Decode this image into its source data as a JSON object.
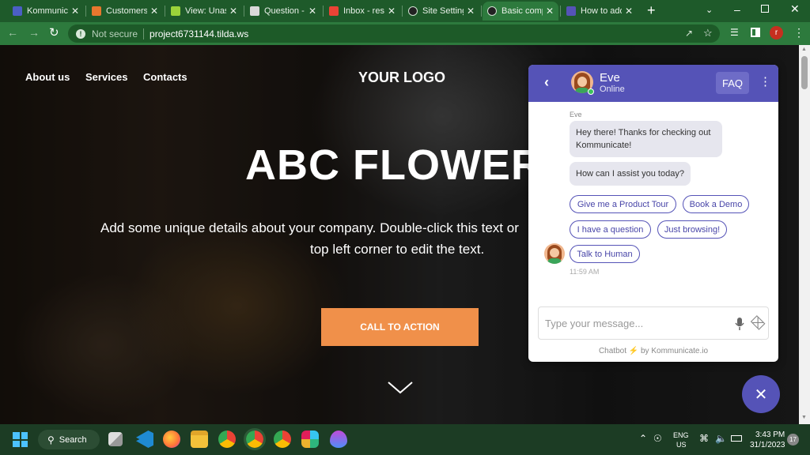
{
  "tabs": [
    {
      "title": "Kommunica",
      "favicon_color": "#4b5fc4",
      "icon": "chat-bubble-icon"
    },
    {
      "title": "Customers",
      "favicon_color": "#e8772e",
      "icon": "c-logo-icon"
    },
    {
      "title": "View: Unas:",
      "favicon_color": "#9bd33a",
      "icon": "slash-icon"
    },
    {
      "title": "Question - !",
      "favicon_color": "#d9d9d9",
      "icon": "document-icon"
    },
    {
      "title": "Inbox - resh",
      "favicon_color": "#ea4335",
      "icon": "gmail-icon"
    },
    {
      "title": "Site Setting",
      "favicon_color": "#222222",
      "icon": "tilda-icon"
    },
    {
      "title": "Basic comp",
      "favicon_color": "#222222",
      "icon": "tilda-icon"
    },
    {
      "title": "How to add",
      "favicon_color": "#5553b7",
      "icon": "kommunicate-icon"
    }
  ],
  "browser": {
    "new_tab": "+",
    "security": "Not secure",
    "url": "project6731144.tilda.ws",
    "profile_initial": "r"
  },
  "site": {
    "nav": [
      "About us",
      "Services",
      "Contacts"
    ],
    "logo": "YOUR LOGO",
    "headline": "ABC FLOWERS",
    "description_line1": "Add some unique details about your company. Double-click this text or",
    "description_line2": "top left corner to edit the text.",
    "cta": "CALL TO ACTION",
    "cta_color": "#f0904a"
  },
  "chat": {
    "agent_name": "Eve",
    "agent_status": "Online",
    "faq": "FAQ",
    "sender_label": "Eve",
    "messages": [
      "Hey there! Thanks for checking out Kommunicate!",
      "How can I assist you today?"
    ],
    "quick_replies": [
      "Give me a Product Tour",
      "Book a Demo",
      "I have a question",
      "Just browsing!",
      "Talk to Human"
    ],
    "time": "11:59 AM",
    "input_placeholder": "Type your message...",
    "footer_prefix": "Chatbot",
    "footer_suffix": "by Kommunicate.io",
    "accent": "#5553b7"
  },
  "taskbar": {
    "search": "Search",
    "lang1": "ENG",
    "lang2": "US",
    "time": "3:43 PM",
    "date": "31/1/2023",
    "notifications": "17"
  }
}
